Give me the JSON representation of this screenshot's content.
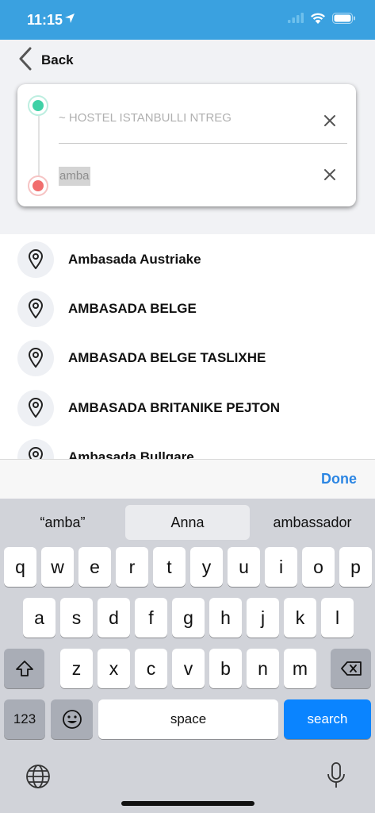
{
  "status": {
    "time": "11:15"
  },
  "nav": {
    "back_label": "Back"
  },
  "route": {
    "from_placeholder": "~ HOSTEL ISTANBULLI NTREG",
    "to_value": "amba"
  },
  "results": [
    {
      "label": "Ambasada Austriake"
    },
    {
      "label": "AMBASADA BELGE"
    },
    {
      "label": "AMBASADA BELGE TASLIXHE"
    },
    {
      "label": "AMBASADA BRITANIKE PEJTON"
    },
    {
      "label": "Ambasada Bullgare"
    }
  ],
  "keyboard": {
    "done_label": "Done",
    "suggestions": [
      "“amba”",
      "Anna",
      "ambassador"
    ],
    "row1": [
      "q",
      "w",
      "e",
      "r",
      "t",
      "y",
      "u",
      "i",
      "o",
      "p"
    ],
    "row2": [
      "a",
      "s",
      "d",
      "f",
      "g",
      "h",
      "j",
      "k",
      "l"
    ],
    "row3": [
      "z",
      "x",
      "c",
      "v",
      "b",
      "n",
      "m"
    ],
    "numbers_label": "123",
    "space_label": "space",
    "search_label": "search"
  },
  "colors": {
    "status_bar": "#3aa1e0",
    "accent": "#2c86e3",
    "search_key": "#0a84ff",
    "origin_dot": "#3fd1a6",
    "destination_dot": "#f16d6d"
  }
}
